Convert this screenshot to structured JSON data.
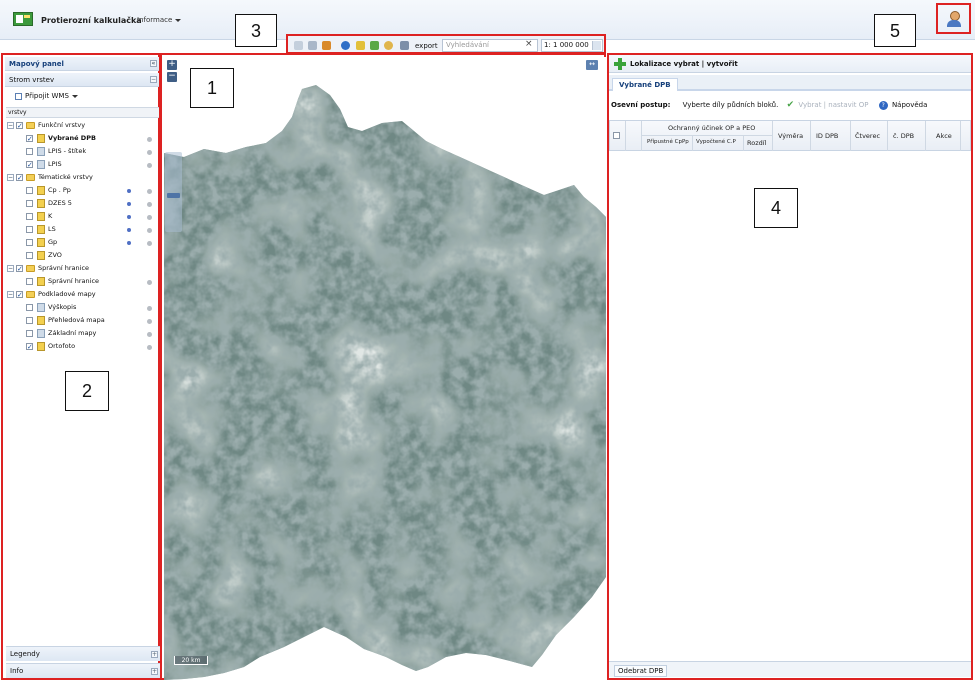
{
  "header": {
    "app_title": "Protierozní kalkulačka",
    "menu_info": "Informace"
  },
  "callouts": [
    "1",
    "2",
    "3",
    "4",
    "5"
  ],
  "toolbar": {
    "export_label": "export",
    "search_placeholder": "Vyhledávání",
    "scale_value": "1: 1 000 000"
  },
  "left_panel": {
    "title": "Mapový panel",
    "collapse_glyph": "«",
    "tree_header": "Strom vrstev",
    "wms_button": "Připojit WMS",
    "columns_header": "vrstvy",
    "layers": [
      {
        "label": "Funkční vrstvy",
        "group": true
      },
      {
        "label": "Vybrané DPB",
        "bold": true
      },
      {
        "label": "LPIS - štítek"
      },
      {
        "label": "LPIS"
      },
      {
        "label": "Tématické vrstvy",
        "group": true
      },
      {
        "label": "Cp . Pp"
      },
      {
        "label": "DZES 5"
      },
      {
        "label": "K"
      },
      {
        "label": "LS"
      },
      {
        "label": "Gp"
      },
      {
        "label": "ZVO"
      },
      {
        "label": "Správní hranice",
        "group": true
      },
      {
        "label": "Správní hranice"
      },
      {
        "label": "Podkladové mapy",
        "group": true
      },
      {
        "label": "Výškopis"
      },
      {
        "label": "Přehledová mapa"
      },
      {
        "label": "Základní mapy"
      },
      {
        "label": "Ortofoto"
      }
    ],
    "legend_label": "Legendy",
    "info_label": "Info"
  },
  "map": {
    "zoom_in": "+",
    "zoom_out": "−",
    "expand_glyph": "↔",
    "scale_text": "20 km"
  },
  "right_panel": {
    "locate_label": "Lokalizace vybrat | vytvořit",
    "tab_label": "Vybrané DPB",
    "proc_label": "Osevní postup:",
    "proc_hint": "Vyberte díly půdních bloků.",
    "select_action": "Vybrat | nastavit OP",
    "help_label": "Nápověda",
    "grid": {
      "group_header": "Ochranný účinek OP a PEO",
      "sub_allowed": "Přípustné CpPp",
      "sub_computed": "Vypočtené C.P",
      "sub_diff": "Rozdíl",
      "col_area": "Výměra",
      "col_id": "ID DPB",
      "col_square": "Čtverec",
      "col_num": "č. DPB",
      "col_action": "Akce"
    },
    "remove_button": "Odebrat DPB"
  },
  "colors": {
    "accent_red": "#dd2222",
    "header_blue": "#16407b",
    "panel_bg": "#eaf0f7"
  }
}
